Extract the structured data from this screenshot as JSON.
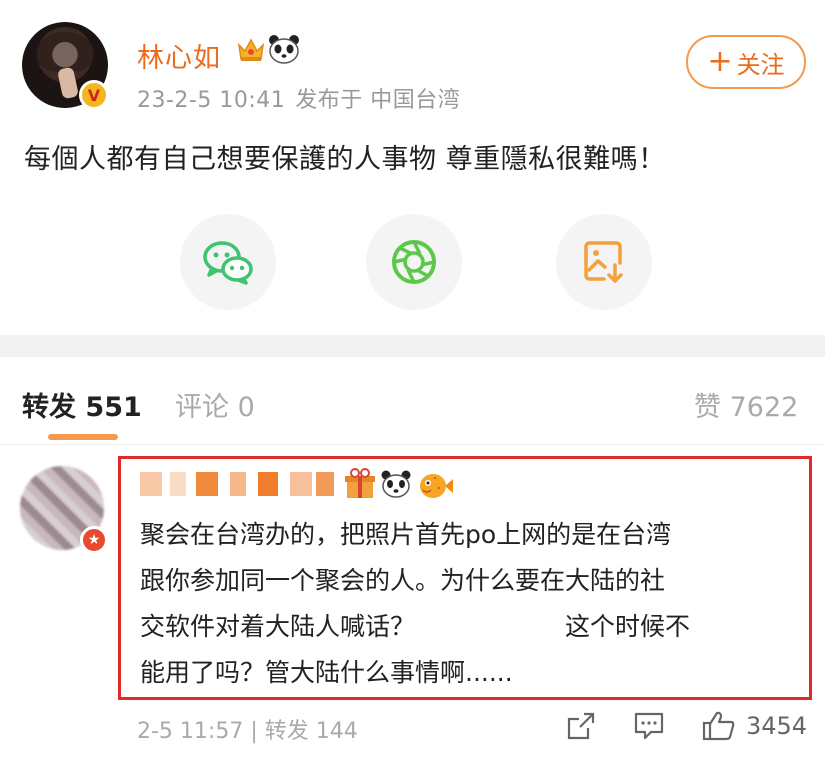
{
  "post": {
    "username": "林心如",
    "timestamp": "23-2-5 10:41",
    "published_from": "发布于 中国台湾",
    "follow_label": "关注",
    "follow_plus": "+",
    "verified_badge": "V",
    "content": "每個人都有自己想要保護的人事物 尊重隱私很難嗎！",
    "share_icons": [
      "wechat-icon",
      "moments-icon",
      "save-image-icon"
    ]
  },
  "tabs": {
    "reposts_label": "转发",
    "reposts_count": "551",
    "comments_label": "评论",
    "comments_count": "0",
    "likes_label": "赞",
    "likes_count": "7622"
  },
  "comment": {
    "lines": [
      "聚会在台湾办的，把照片首先po上网的是在台湾",
      "跟你参加同一个聚会的人。为什么要在大陆的社",
      "交软件对着大陆人喊话？",
      "这个时候不",
      "能用了吗？管大陆什么事情啊......"
    ],
    "time": "2-5 11:57",
    "separator": "|",
    "repost_label": "转发 144",
    "like_count": "3454"
  },
  "colors": {
    "accent": "#ec6b1d",
    "follow_border": "#f39a4e",
    "highlight_box": "#e02a2a",
    "wechat_green": "#3cc46e",
    "moments_green": "#5bc84a",
    "save_orange": "#f2a23c"
  }
}
